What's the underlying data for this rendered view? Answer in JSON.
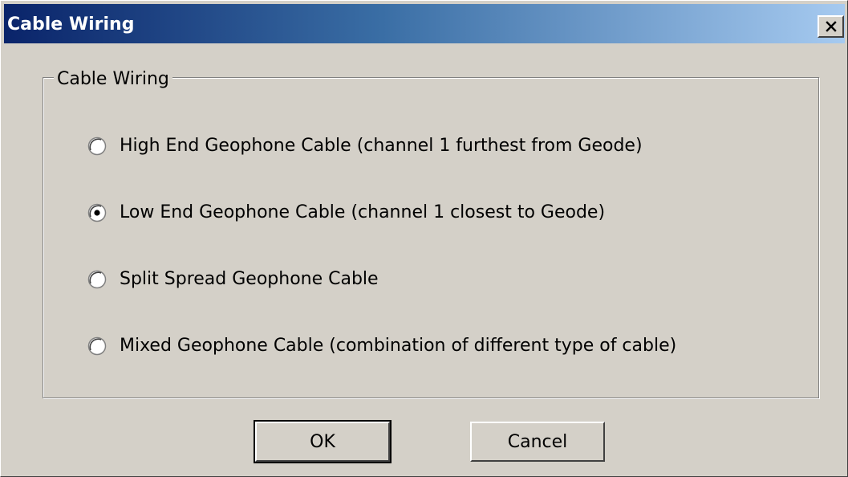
{
  "window": {
    "title": "Cable Wiring",
    "close_glyph": "X"
  },
  "group": {
    "legend": "Cable Wiring",
    "options": [
      {
        "label": "High End Geophone Cable  (channel 1 furthest from Geode)",
        "selected": false
      },
      {
        "label": "Low End Geophone Cable (channel 1 closest to Geode)",
        "selected": true
      },
      {
        "label": "Split Spread Geophone Cable",
        "selected": false
      },
      {
        "label": "Mixed Geophone Cable (combination of different type of cable)",
        "selected": false
      }
    ]
  },
  "buttons": {
    "ok_label": "OK",
    "cancel_label": "Cancel"
  },
  "colors": {
    "titlebar_start": "#0a246a",
    "titlebar_end": "#a6caf0",
    "face": "#d4d0c8"
  }
}
